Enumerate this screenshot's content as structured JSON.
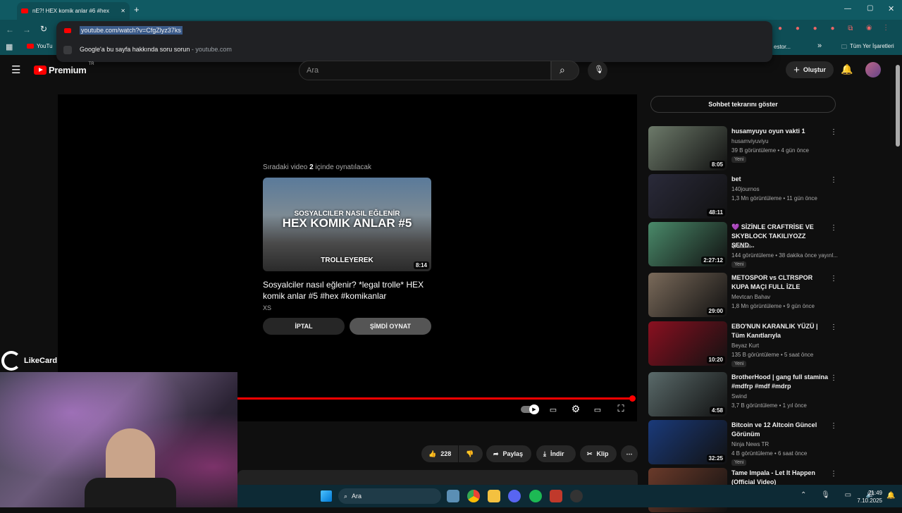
{
  "browser": {
    "tab_title": "nE?! HEX komik anlar #6 #hex",
    "url": "youtube.com/watch?v=CfgZlyz37ks",
    "omni_suggestion": "Google'a bu sayfa hakkında soru sorun",
    "omni_suggestion_domain": "- youtube.com",
    "bookmark_youtube": "YouTu",
    "bookmark_estor": "estor...",
    "bookmark_all": "Tüm Yer İşaretleri"
  },
  "youtube": {
    "logo": "Premium",
    "region": "TR",
    "search_placeholder": "Ara",
    "create_label": "Oluştur"
  },
  "player": {
    "next_prefix": "Sıradaki video",
    "next_seconds": "2",
    "next_suffix": "içinde oynatılacak",
    "next_thumb_line1": "SOSYALCILER NASIL EĞLENİR",
    "next_thumb_line2": "HEX KOMIK ANLAR #5",
    "next_thumb_line3": "TROLLEYEREK",
    "next_duration": "8:14",
    "next_title": "Sosyalciler nasıl eğlenir? *legal trolle* HEX komik anlar #5 #hex #komikanlar",
    "next_channel": "XS",
    "cancel_label": "İPTAL",
    "play_now_label": "ŞİMDİ OYNAT",
    "progress_fraction": 1.0
  },
  "actions": {
    "like_count": "228",
    "share_label": "Paylaş",
    "download_label": "İndir",
    "clip_label": "Klip"
  },
  "sidebar": {
    "chat_replay_label": "Sohbet tekrarını göster",
    "items": [
      {
        "title": "husamyuyu oyun vakti 1",
        "channel": "husamviyuviyu",
        "meta": "39 B görüntüleme • 4 gün önce",
        "badge": "Yeni",
        "duration": "8:05",
        "color": "#6d7a6a"
      },
      {
        "title": "bet",
        "channel": "140journos",
        "meta": "1,3 Mn görüntüleme • 11 gün önce",
        "badge": "",
        "duration": "48:11",
        "color": "#2a2a3a"
      },
      {
        "title": "💜 SİZİNLE CRAFTRİSE VE SKYBLOCK TAKILIYOZZ SEND...",
        "channel": "qKaann",
        "meta": "144 görüntüleme • 38 dakika önce yayınl...",
        "badge": "Yeni",
        "duration": "2:27:12",
        "color": "#4a8a6a"
      },
      {
        "title": "METOSPOR vs CLTRSPOR KUPA MAÇI FULL İZLE",
        "channel": "Mevtcan Bahav",
        "meta": "1,8 Mn görüntüleme • 9 gün önce",
        "badge": "",
        "duration": "29:00",
        "color": "#7a6a5a"
      },
      {
        "title": "EBO'NUN KARANLIK YÜZÜ | Tüm Kanıtlarıyla",
        "channel": "Beyaz Kurt",
        "meta": "135 B görüntüleme • 5 saat önce",
        "badge": "Yeni",
        "duration": "10:20",
        "color": "#8a1020"
      },
      {
        "title": "BrotherHood | gang full stamina #mdfrp #mdf #mdrp",
        "channel": "Swind",
        "meta": "3,7 B görüntüleme • 1 yıl önce",
        "badge": "",
        "duration": "4:58",
        "color": "#5a6a6a"
      },
      {
        "title": "Bitcoin ve 12 Altcoin Güncel Görünüm",
        "channel": "Ninja News TR",
        "meta": "4 B görüntüleme • 6 saat önce",
        "badge": "Yeni",
        "duration": "32:25",
        "color": "#1a3a7a"
      },
      {
        "title": "Tame Impala - Let It Happen (Official Video)",
        "channel": "",
        "meta": "",
        "badge": "",
        "duration": "",
        "color": "#6a3a2a"
      }
    ]
  },
  "overlay": {
    "likecard": "LikeCard"
  },
  "taskbar": {
    "search": "Ara",
    "time": "21:49",
    "date": "7.10.2025"
  }
}
